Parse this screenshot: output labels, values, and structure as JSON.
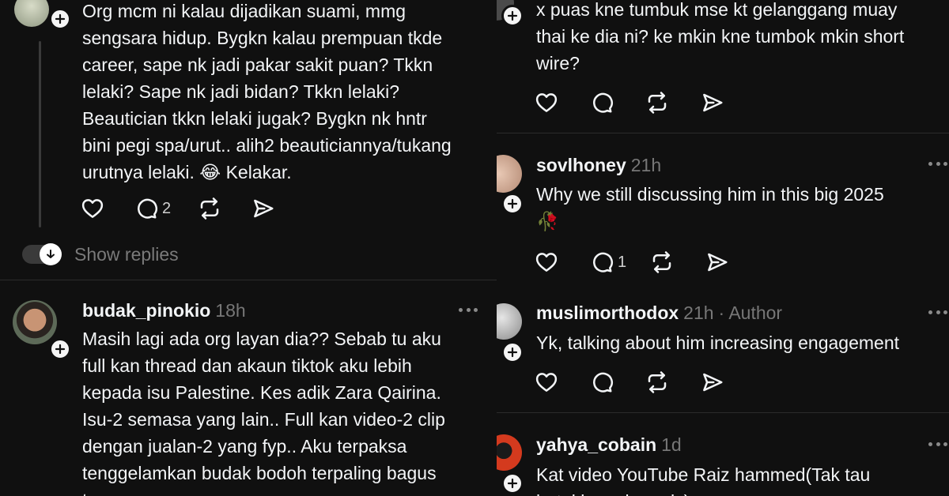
{
  "left": {
    "post1": {
      "lines": [
        "Org mcm ni kalau dijadikan suami, mmg",
        "sengsara hidup. Bygkn kalau prempuan tkde",
        "career, sape nk jadi pakar sakit puan? Tkkn",
        "lelaki? Sape nk jadi bidan? Tkkn lelaki?",
        "Beautician tkkn lelaki jugak? Bygkn nk hntr",
        "bini pegi spa/urut.. alih2 beauticiannya/tukang",
        "urutnya lelaki. 😂 Kelakar."
      ],
      "reply_count": "2"
    },
    "show_replies": "Show replies",
    "post2": {
      "username": "budak_pinokio",
      "time": "18h",
      "lines": [
        "Masih lagi ada org layan dia?? Sebab tu aku",
        "full kan thread dan akaun tiktok aku lebih",
        "kepada isu Palestine. Kes adik Zara Qairina.",
        "Isu-2 semasa yang lain.. Full kan video-2 clip",
        "dengan jualan-2 yang fyp.. Aku terpaksa",
        "tenggelamkan budak bodoh terpaling bagus",
        "tu..."
      ]
    }
  },
  "right": {
    "post1": {
      "lines": [
        "x puas kne tumbuk mse kt gelanggang muay",
        "thai ke dia ni? ke mkin kne tumbok mkin short",
        "wire?"
      ]
    },
    "post2": {
      "username": "sovlhoney",
      "time": "21h",
      "lines": [
        "Why we still discussing him in this big 2025",
        "🥀"
      ],
      "reply_count": "1"
    },
    "post3": {
      "username": "muslimorthodox",
      "time": "21h",
      "author_tag": "· Author",
      "lines": [
        "Yk, talking about him increasing engagement"
      ]
    },
    "post4": {
      "username": "yahya_cobain",
      "time": "1d",
      "lines": [
        "Kat video YouTube Raiz hammed(Tak tau",
        "betul kan ejaan dy) ..."
      ]
    }
  },
  "icons": {
    "like": "heart-icon",
    "reply": "speech-bubble-icon",
    "repost": "repost-icon",
    "share": "send-icon",
    "more": "more-dots-icon",
    "follow": "plus-icon",
    "expand": "arrow-down-icon"
  }
}
